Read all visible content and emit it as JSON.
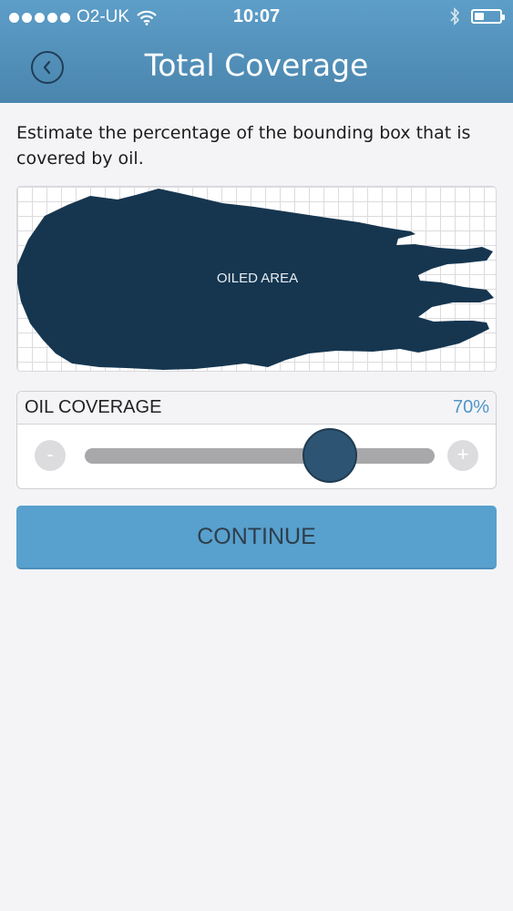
{
  "status_bar": {
    "carrier": "O2-UK",
    "time": "10:07",
    "signal_icon": "signal-dots-icon",
    "wifi_icon": "wifi-icon",
    "bluetooth_icon": "bluetooth-icon",
    "battery_level": 0.4
  },
  "header": {
    "title": "Total Coverage",
    "back_icon": "chevron-left-icon"
  },
  "instruction": "Estimate the percentage of the bounding box that is covered by oil.",
  "oil_image": {
    "label": "OILED AREA",
    "oil_color": "#163650"
  },
  "coverage": {
    "label": "OIL COVERAGE",
    "value_text": "70%",
    "value": 0.7,
    "minus_label": "-",
    "plus_label": "+"
  },
  "continue_label": "CONTINUE",
  "colors": {
    "header": "#5096c2",
    "accent": "#4f95c4",
    "button": "#58a0cd"
  }
}
